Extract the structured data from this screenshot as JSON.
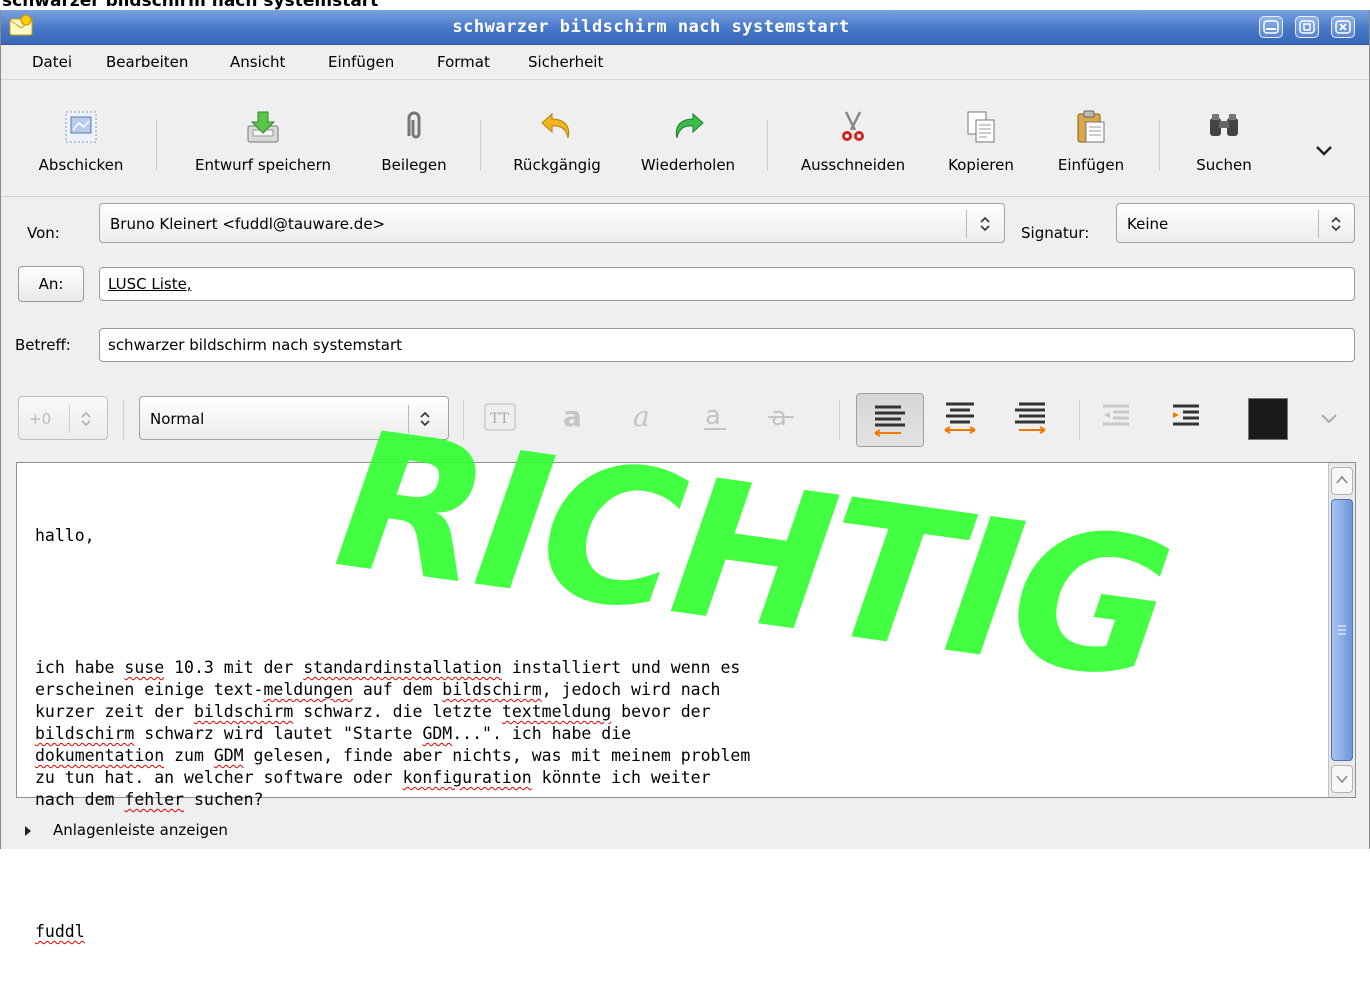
{
  "heading": "schwarzer bildschirm nach systemstart",
  "window": {
    "title": "schwarzer bildschirm nach systemstart"
  },
  "menubar": {
    "items": [
      "Datei",
      "Bearbeiten",
      "Ansicht",
      "Einfügen",
      "Format",
      "Sicherheit"
    ]
  },
  "toolbar": {
    "send": "Abschicken",
    "save_draft": "Entwurf speichern",
    "attach": "Beilegen",
    "undo": "Rückgängig",
    "redo": "Wiederholen",
    "cut": "Ausschneiden",
    "copy": "Kopieren",
    "paste": "Einfügen",
    "find": "Suchen"
  },
  "header": {
    "from_label": "Von:",
    "from_value": "Bruno Kleinert <fuddl@tauware.de>",
    "signature_label": "Signatur:",
    "signature_value": "Keine",
    "to_button": "An:",
    "to_value": "LUSC Liste,",
    "subject_label": "Betreff:",
    "subject_value": "schwarzer bildschirm nach systemstart"
  },
  "formatbar": {
    "font_size": "+0",
    "paragraph_style": "Normal",
    "text_color": "#1a1a1a"
  },
  "body": {
    "greeting": "hallo,",
    "signature": "fuddl"
  },
  "watermark": "RICHTIG",
  "attachments": {
    "toggle_label": "Anlagenleiste anzeigen"
  }
}
